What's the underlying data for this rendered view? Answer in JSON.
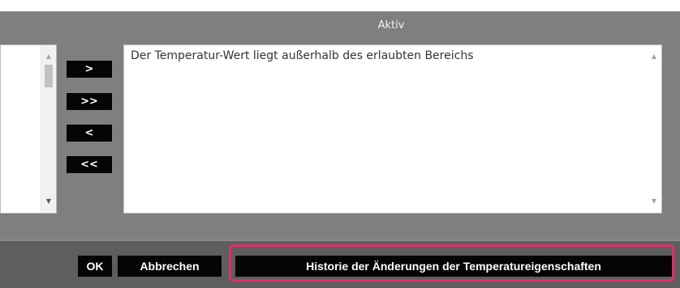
{
  "colors": {
    "panel_bg": "#7f7f7f",
    "footer_bg": "#5e5e5e",
    "button_bg": "#050505",
    "highlight": "#e0306a"
  },
  "active_section": {
    "title": "Aktiv",
    "items": [
      "Der Temperatur-Wert liegt außerhalb des erlaubten Bereichs"
    ]
  },
  "transfer_buttons": {
    "move_one": ">",
    "move_all": ">>",
    "remove_one": "<",
    "remove_all": "<<"
  },
  "scroll_icons": {
    "up": "▲",
    "down": "▼"
  },
  "footer": {
    "ok_label": "OK",
    "cancel_label": "Abbrechen",
    "history_label": "Historie der Änderungen der Temperatureigenschaften"
  }
}
